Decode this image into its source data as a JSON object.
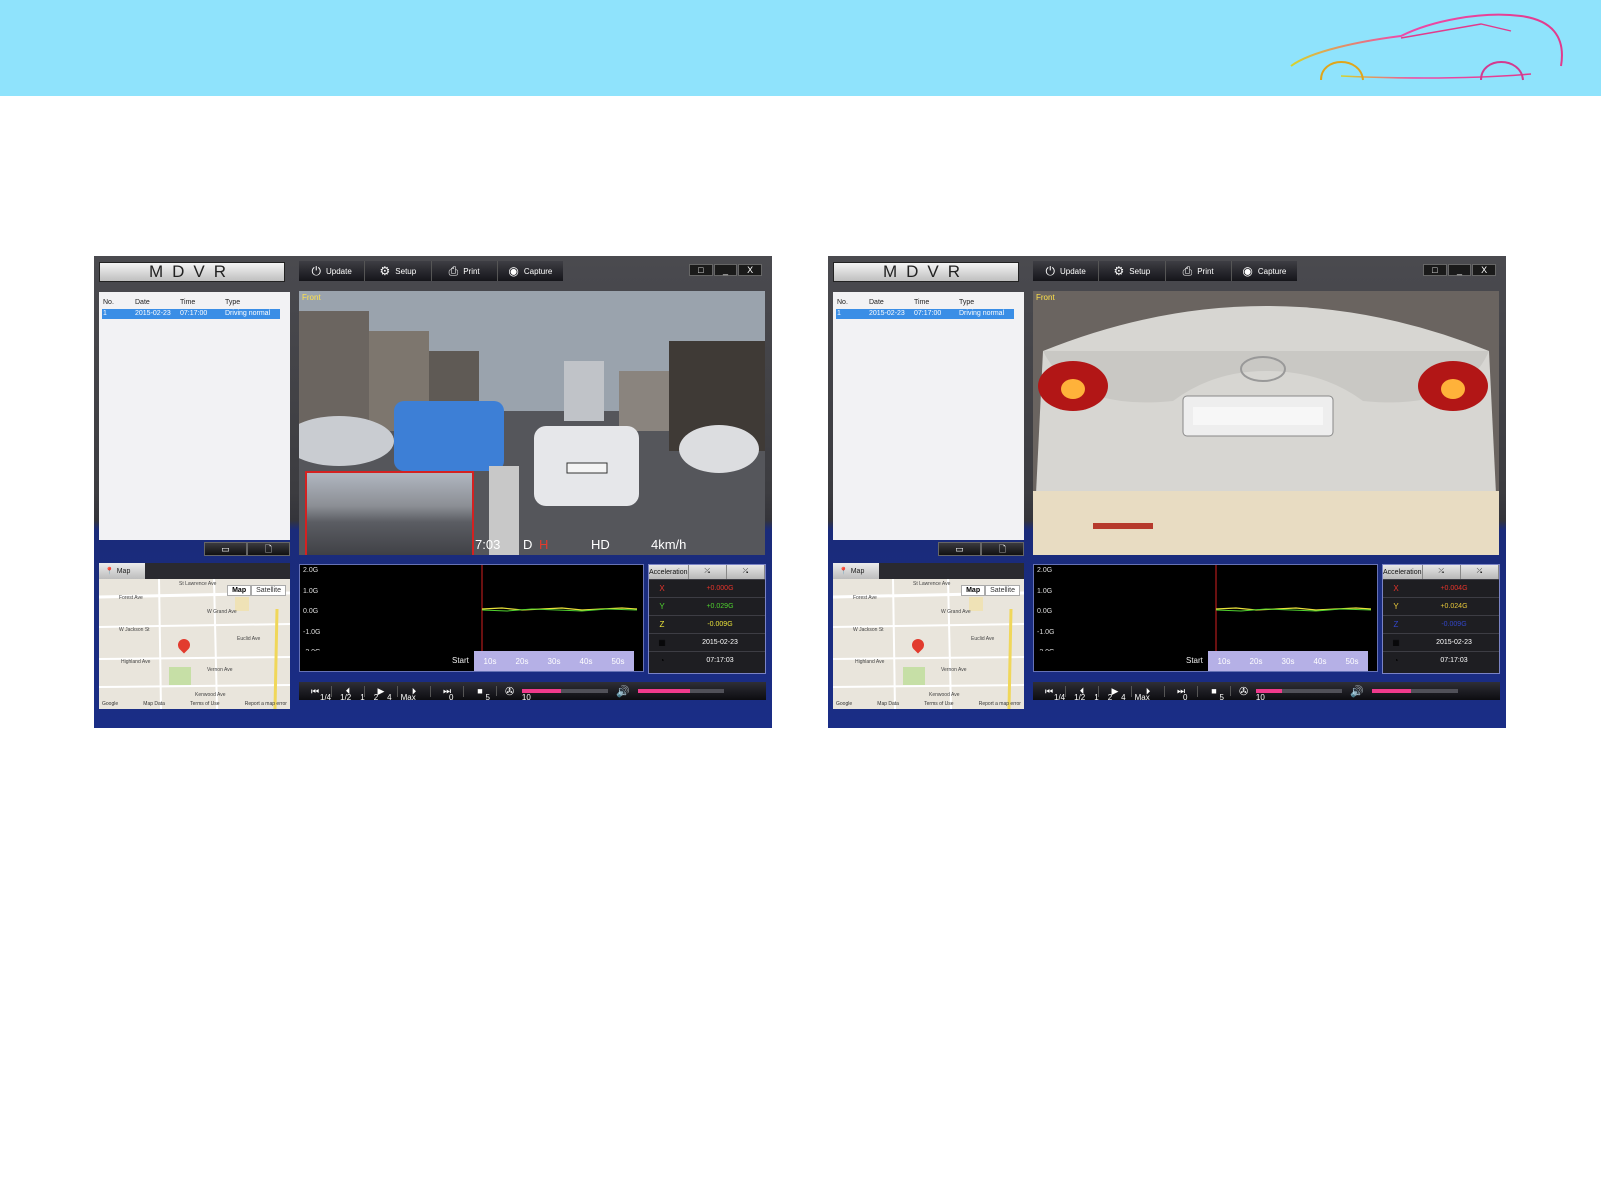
{
  "apps": [
    {
      "id": "left",
      "logo": "MDVR",
      "toolbar": [
        {
          "label": "Update",
          "icon": "update-icon",
          "glyph": "⏻"
        },
        {
          "label": "Setup",
          "icon": "gear-icon",
          "glyph": "⚙"
        },
        {
          "label": "Print",
          "icon": "print-icon",
          "glyph": "⎙"
        },
        {
          "label": "Capture",
          "icon": "camera-icon",
          "glyph": "◉"
        }
      ],
      "window_controls": [
        "□",
        "_",
        "X"
      ],
      "event_list": {
        "columns": [
          "No.",
          "Date",
          "Time",
          "Type"
        ],
        "rows": [
          [
            "1",
            "2015-02-23",
            "07:17:00",
            "Driving normal"
          ]
        ]
      },
      "video": {
        "label": "Front",
        "osd": {
          "time": "7:03",
          "d": "D",
          "h": "H",
          "quality": "HD",
          "speed": "4km/h"
        },
        "scene": "street",
        "pip": true
      },
      "map": {
        "tab": "Map",
        "types": [
          "Map",
          "Satellite"
        ],
        "streets": [
          "St Lawrence Ave",
          "Forest Ave",
          "W Grand Ave",
          "W Jackson St",
          "Euclid Ave",
          "Highland Ave",
          "Vernon Ave",
          "Kenwood Ave"
        ],
        "footer": [
          "Google",
          "Map Data",
          "Terms of Use",
          "Report a map error"
        ]
      },
      "gsensor": {
        "y_ticks": [
          "2.0G",
          "1.0G",
          "0.0G",
          "-1.0G",
          "-2.0G"
        ],
        "start_label": "Start",
        "timeline": [
          "10s",
          "20s",
          "30s",
          "40s",
          "50s"
        ]
      },
      "acceleration": {
        "header": "Acceleration",
        "rows": [
          {
            "key": "X",
            "value": "+0.000G",
            "color": "#e5342b"
          },
          {
            "key": "Y",
            "value": "+0.029G",
            "color": "#4fd02f"
          },
          {
            "key": "Z",
            "value": "-0.009G",
            "color": "#e8e13a"
          }
        ],
        "date": "2015-02-23",
        "time": "07:17:03"
      },
      "speed_labels": [
        "1/4",
        "1/2",
        "1",
        "2",
        "4",
        "Max"
      ],
      "volume_labels": [
        "0",
        "5",
        "10"
      ],
      "speed_level": 0.45,
      "volume_level": 0.6
    },
    {
      "id": "right",
      "logo": "MDVR",
      "toolbar": [
        {
          "label": "Update",
          "icon": "update-icon",
          "glyph": "⏻"
        },
        {
          "label": "Setup",
          "icon": "gear-icon",
          "glyph": "⚙"
        },
        {
          "label": "Print",
          "icon": "print-icon",
          "glyph": "⎙"
        },
        {
          "label": "Capture",
          "icon": "camera-icon",
          "glyph": "◉"
        }
      ],
      "window_controls": [
        "□",
        "_",
        "X"
      ],
      "event_list": {
        "columns": [
          "No.",
          "Date",
          "Time",
          "Type"
        ],
        "rows": [
          [
            "1",
            "2015-02-23",
            "07:17:00",
            "Driving normal"
          ]
        ]
      },
      "video": {
        "label": "Front",
        "osd": {
          "time": "",
          "d": "",
          "h": "",
          "quality": "",
          "speed": ""
        },
        "scene": "car-rear",
        "pip": false
      },
      "map": {
        "tab": "Map",
        "types": [
          "Map",
          "Satellite"
        ],
        "streets": [
          "St Lawrence Ave",
          "Forest Ave",
          "W Grand Ave",
          "W Jackson St",
          "Euclid Ave",
          "Highland Ave",
          "Vernon Ave",
          "Kenwood Ave"
        ],
        "footer": [
          "Google",
          "Map Data",
          "Terms of Use",
          "Report a map error"
        ]
      },
      "gsensor": {
        "y_ticks": [
          "2.0G",
          "1.0G",
          "0.0G",
          "-1.0G",
          "-2.0G"
        ],
        "start_label": "Start",
        "timeline": [
          "10s",
          "20s",
          "30s",
          "40s",
          "50s"
        ]
      },
      "acceleration": {
        "header": "Acceleration",
        "rows": [
          {
            "key": "X",
            "value": "+0.004G",
            "color": "#e5342b"
          },
          {
            "key": "Y",
            "value": "+0.024G",
            "color": "#e8c93a"
          },
          {
            "key": "Z",
            "value": "-0.009G",
            "color": "#3346c9"
          }
        ],
        "date": "2015-02-23",
        "time": "07:17:03"
      },
      "speed_labels": [
        "1/4",
        "1/2",
        "1",
        "2",
        "4",
        "Max"
      ],
      "volume_labels": [
        "0",
        "5",
        "10"
      ],
      "speed_level": 0.3,
      "volume_level": 0.45
    }
  ]
}
